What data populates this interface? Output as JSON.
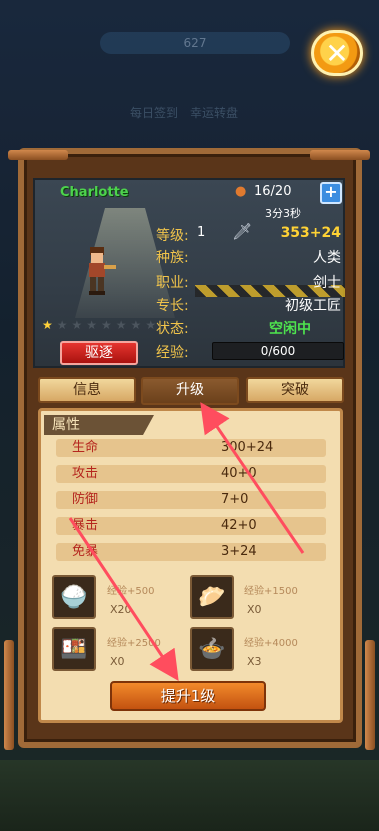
{
  "background": {
    "top_counter": "627",
    "labels": [
      "每日签到",
      "幸运转盘"
    ]
  },
  "close_icon": "close-x-icon",
  "character": {
    "name": "Charlotte",
    "stamina": "16/20",
    "timer": "3分3秒",
    "level_label": "等级:",
    "level_value": "1",
    "power": "353+24",
    "race_label": "种族:",
    "race_value": "人类",
    "job_label": "职业:",
    "job_value": "剑士",
    "specialty_label": "专长:",
    "specialty_value": "初级工匠",
    "status_label": "状态:",
    "status_value": "空闲中",
    "exp_label": "经验:",
    "exp_value": "0/600",
    "stars_filled": 1,
    "stars_total": 8,
    "expel_label": "驱逐"
  },
  "tabs": [
    {
      "label": "信息",
      "active": false
    },
    {
      "label": "升级",
      "active": true
    },
    {
      "label": "突破",
      "active": false
    }
  ],
  "attributes": {
    "title": "属性",
    "rows": [
      {
        "name": "生命",
        "value": "300+24"
      },
      {
        "name": "攻击",
        "value": "40+0"
      },
      {
        "name": "防御",
        "value": "7+0"
      },
      {
        "name": "暴击",
        "value": "42+0"
      },
      {
        "name": "免暴",
        "value": "3+24"
      }
    ]
  },
  "items": [
    {
      "icon": "rice-bowl-icon",
      "exp": "经验+500",
      "qty": "X20"
    },
    {
      "icon": "dumpling-icon",
      "exp": "经验+1500",
      "qty": "X0"
    },
    {
      "icon": "dish-icon",
      "exp": "经验+2500",
      "qty": "X0"
    },
    {
      "icon": "hotpot-icon",
      "exp": "经验+4000",
      "qty": "X3"
    }
  ],
  "upgrade_label": "提升1级",
  "colors": {
    "accent_orange": "#f28a2b",
    "status_green": "#4ee34e",
    "gold": "#ffd235",
    "panel_brown": "#5a3519"
  }
}
